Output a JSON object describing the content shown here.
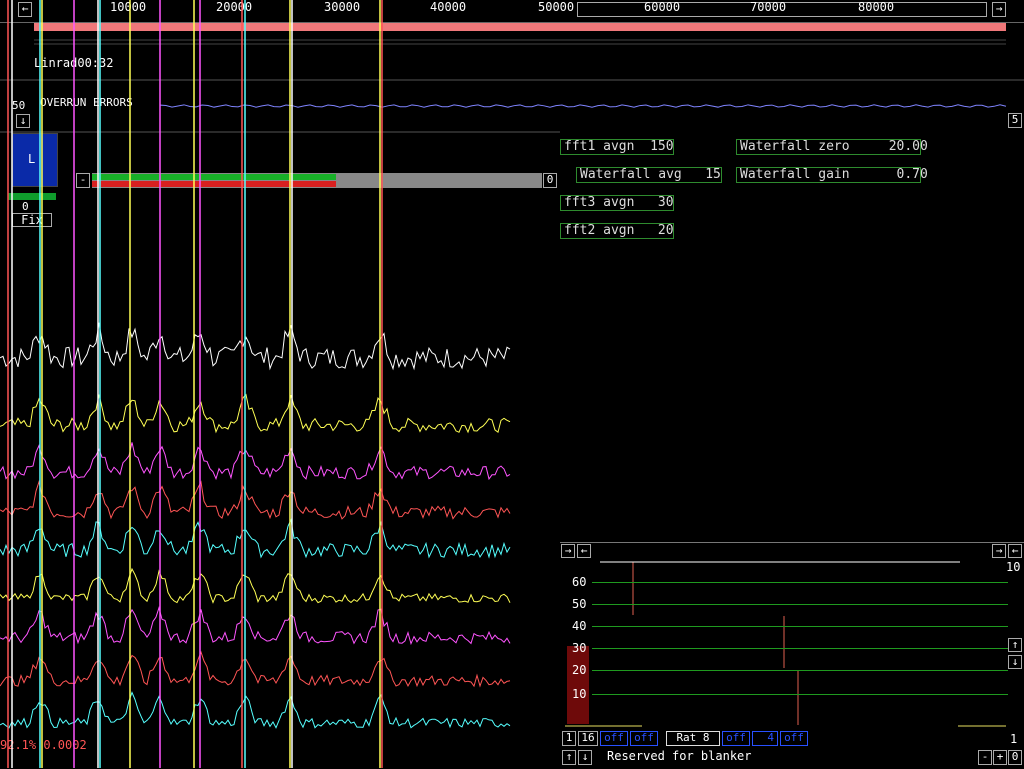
{
  "top_axis": {
    "ticks": [
      "10000",
      "20000",
      "30000",
      "40000",
      "50000",
      "60000",
      "70000",
      "80000"
    ]
  },
  "left_panel": {
    "filename": "Linrad00:32",
    "overrun_label": "OVERRUN ERRORS",
    "level_value": "50",
    "meter_value": "0",
    "fix_label": "Fix",
    "meter_letter": "L",
    "scroll_right_value": "5"
  },
  "controls": {
    "fft1_avgn": "fft1 avgn  150",
    "waterfall_avg": "Waterfall avg   15",
    "fft3_avgn": "fft3 avgn   30",
    "fft2_avgn": "fft2 avgn   20",
    "waterfall_zero": "Waterfall zero     20.00",
    "waterfall_gain": "Waterfall gain      0.70"
  },
  "status_readout": "92.1% 0.0002",
  "bar_end_value": "0",
  "spectrum_colors": [
    "#ffffff",
    "#ffff55",
    "#ff55ff",
    "#ff5555",
    "#55ffff",
    "#ffff55",
    "#ff55ff",
    "#ff5555",
    "#55ffff"
  ],
  "s_meter": {
    "y_ticks": [
      "60",
      "50",
      "40",
      "30",
      "20",
      "10"
    ],
    "right_top": "10",
    "right_bottom": "1",
    "level_fraction": 0.35,
    "left_ctrl_1": "1",
    "left_ctrl_2": "16",
    "off_labels": [
      "off",
      "off",
      "off",
      "off"
    ],
    "rat_label": "Rat  8",
    "num_box": "4",
    "blanker_label": "Reserved for blanker",
    "minus_btn": "-",
    "plus_btn": "+",
    "zero_btn": "0"
  },
  "icons": {
    "left_arrow": "←",
    "right_arrow": "→",
    "up_arrow": "↑",
    "down_arrow": "↓"
  }
}
